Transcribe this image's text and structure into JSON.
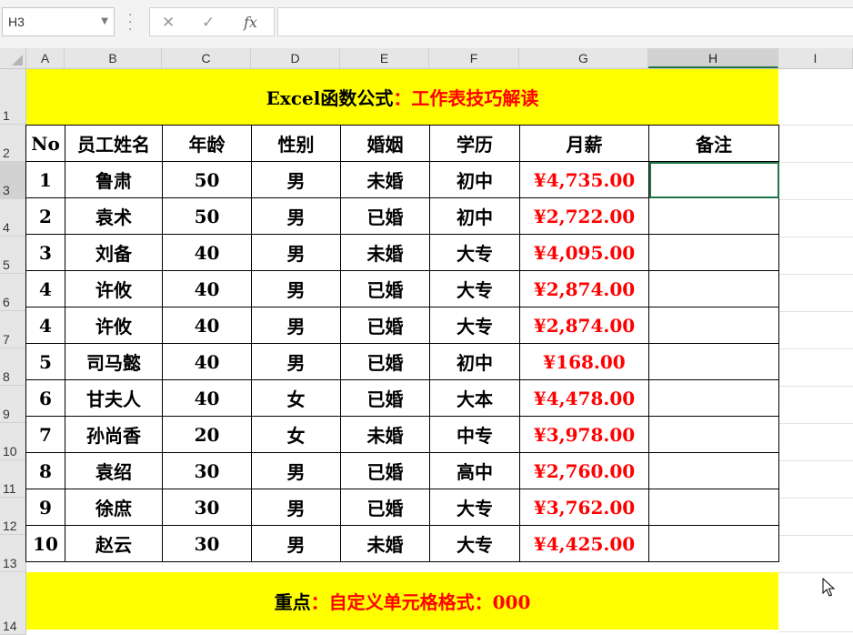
{
  "name_box": {
    "value": "H3"
  },
  "formula_bar": {
    "cancel_icon": "close-icon",
    "enter_icon": "check-icon",
    "fx_label": "fx",
    "content": ""
  },
  "columns": [
    "A",
    "B",
    "C",
    "D",
    "E",
    "F",
    "G",
    "H",
    "I"
  ],
  "rows": [
    "1",
    "2",
    "3",
    "4",
    "5",
    "6",
    "7",
    "8",
    "9",
    "10",
    "11",
    "12",
    "13",
    "14"
  ],
  "title": {
    "black": "Excel函数公式",
    "red": "：工作表技巧解读"
  },
  "table": {
    "headers": [
      "No",
      "员工姓名",
      "年龄",
      "性别",
      "婚姻",
      "学历",
      "月薪",
      "备注"
    ],
    "rows": [
      [
        "1",
        "鲁肃",
        "50",
        "男",
        "未婚",
        "初中",
        "¥4,735.00",
        ""
      ],
      [
        "2",
        "袁术",
        "50",
        "男",
        "已婚",
        "初中",
        "¥2,722.00",
        ""
      ],
      [
        "3",
        "刘备",
        "40",
        "男",
        "未婚",
        "大专",
        "¥4,095.00",
        ""
      ],
      [
        "4",
        "许攸",
        "40",
        "男",
        "已婚",
        "大专",
        "¥2,874.00",
        ""
      ],
      [
        "4",
        "许攸",
        "40",
        "男",
        "已婚",
        "大专",
        "¥2,874.00",
        ""
      ],
      [
        "5",
        "司马懿",
        "40",
        "男",
        "已婚",
        "初中",
        "¥168.00",
        ""
      ],
      [
        "6",
        "甘夫人",
        "40",
        "女",
        "已婚",
        "大本",
        "¥4,478.00",
        ""
      ],
      [
        "7",
        "孙尚香",
        "20",
        "女",
        "未婚",
        "中专",
        "¥3,978.00",
        ""
      ],
      [
        "8",
        "袁绍",
        "30",
        "男",
        "已婚",
        "高中",
        "¥2,760.00",
        ""
      ],
      [
        "9",
        "徐庶",
        "30",
        "男",
        "已婚",
        "大专",
        "¥3,762.00",
        ""
      ],
      [
        "10",
        "赵云",
        "30",
        "男",
        "未婚",
        "大专",
        "¥4,425.00",
        ""
      ]
    ]
  },
  "footer": {
    "black": "重点",
    "red": "：自定义单元格格式：000"
  },
  "colors": {
    "banner_bg": "#ffff00",
    "red_text": "#ff0000",
    "selection": "#217346"
  }
}
